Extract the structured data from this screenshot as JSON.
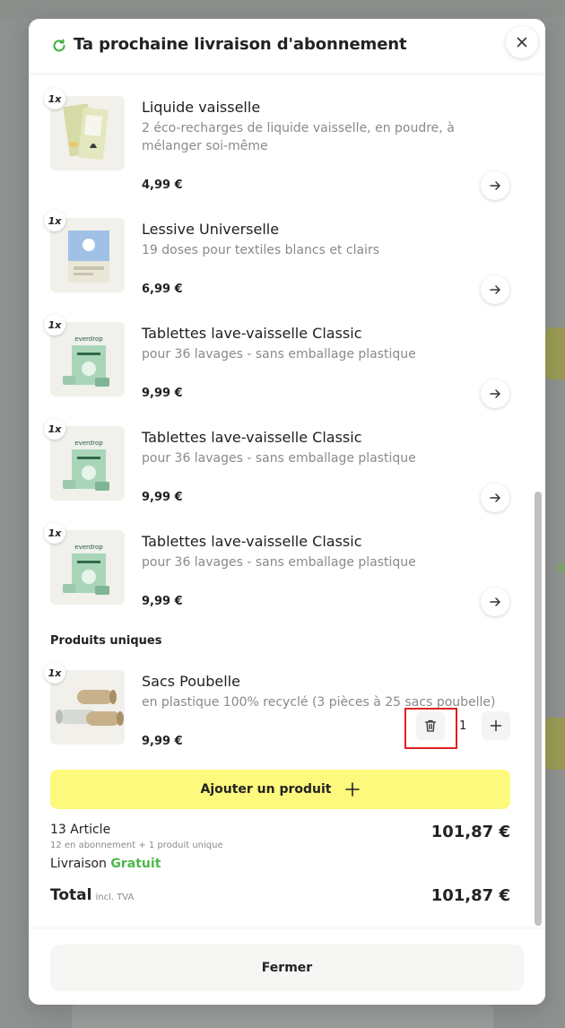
{
  "modal": {
    "title": "Ta prochaine livraison d'abonnement",
    "close_icon": "close-icon",
    "refresh_icon": "refresh-icon"
  },
  "subscription_items": [
    {
      "qty": "1x",
      "name": "Liquide vaisselle",
      "description": "2 éco-recharges de liquide vaisselle, en poudre, à mélanger soi-même",
      "price": "4,99 €"
    },
    {
      "qty": "1x",
      "name": "Lessive Universelle",
      "description": "19 doses pour textiles blancs et clairs",
      "price": "6,99 €"
    },
    {
      "qty": "1x",
      "name": "Tablettes lave-vaisselle Classic",
      "description": "pour 36 lavages - sans emballage plastique",
      "price": "9,99 €"
    },
    {
      "qty": "1x",
      "name": "Tablettes lave-vaisselle Classic",
      "description": "pour 36 lavages - sans emballage plastique",
      "price": "9,99 €"
    },
    {
      "qty": "1x",
      "name": "Tablettes lave-vaisselle Classic",
      "description": "pour 36 lavages - sans emballage plastique",
      "price": "9,99 €"
    }
  ],
  "unique_section": {
    "title": "Produits uniques",
    "item": {
      "qty": "1x",
      "name": "Sacs Poubelle",
      "description": "en plastique 100% recyclé (3 pièces à 25 sacs poubelle)",
      "price": "9,99 €",
      "quantity": "1"
    }
  },
  "add_product": {
    "label": "Ajouter un produit"
  },
  "summary": {
    "articles": "13 Article",
    "articles_sub": "12 en abonnement + 1 produit unique",
    "subtotal": "101,87 €",
    "delivery_label": "Livraison",
    "delivery_value": "Gratuit",
    "total_label": "Total",
    "total_tva": "incl. TVA",
    "total": "101,87 €"
  },
  "footer": {
    "close_label": "Fermer"
  },
  "colors": {
    "accent_yellow": "#fdf97c",
    "free_green": "#4cb94a",
    "highlight_red": "#e02020"
  }
}
